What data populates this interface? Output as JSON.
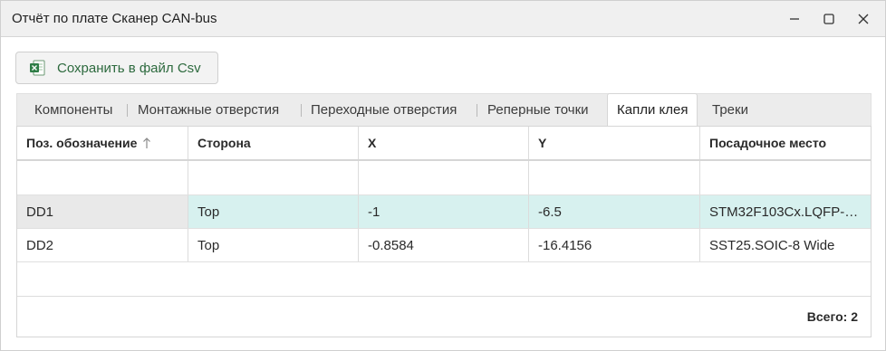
{
  "window": {
    "title": "Отчёт по плате Сканер CAN-bus",
    "controls": [
      "minimize-icon",
      "maximize-icon",
      "close-icon"
    ]
  },
  "toolbar": {
    "save_label": "Сохранить в файл Csv",
    "save_icon": "excel-file-icon"
  },
  "tabs": [
    {
      "label": "Компоненты",
      "active": false
    },
    {
      "label": "Монтажные отверстия",
      "active": false
    },
    {
      "label": "Переходные отверстия",
      "active": false
    },
    {
      "label": "Реперные точки",
      "active": false
    },
    {
      "label": "Капли клея",
      "active": true
    },
    {
      "label": "Треки",
      "active": false
    }
  ],
  "table": {
    "columns": [
      "Поз. обозначение",
      "Сторона",
      "X",
      "Y",
      "Посадочное место"
    ],
    "sort_column": "Поз. обозначение",
    "sort_direction": "ascending",
    "rows": [
      {
        "designator": "DD1",
        "side": "Top",
        "x": "-1",
        "y": "-6.5",
        "footprint": "STM32F103Cx.LQFP-…"
      },
      {
        "designator": "DD2",
        "side": "Top",
        "x": "-0.8584",
        "y": "-16.4156",
        "footprint": "SST25.SOIC-8 Wide"
      }
    ],
    "selected_row": 0,
    "total_label": "Всего: 2"
  },
  "colors": {
    "selected_row": "#d7f1ef",
    "save_label": "#2d6a3e",
    "titlebar": "#f0f0f0"
  }
}
